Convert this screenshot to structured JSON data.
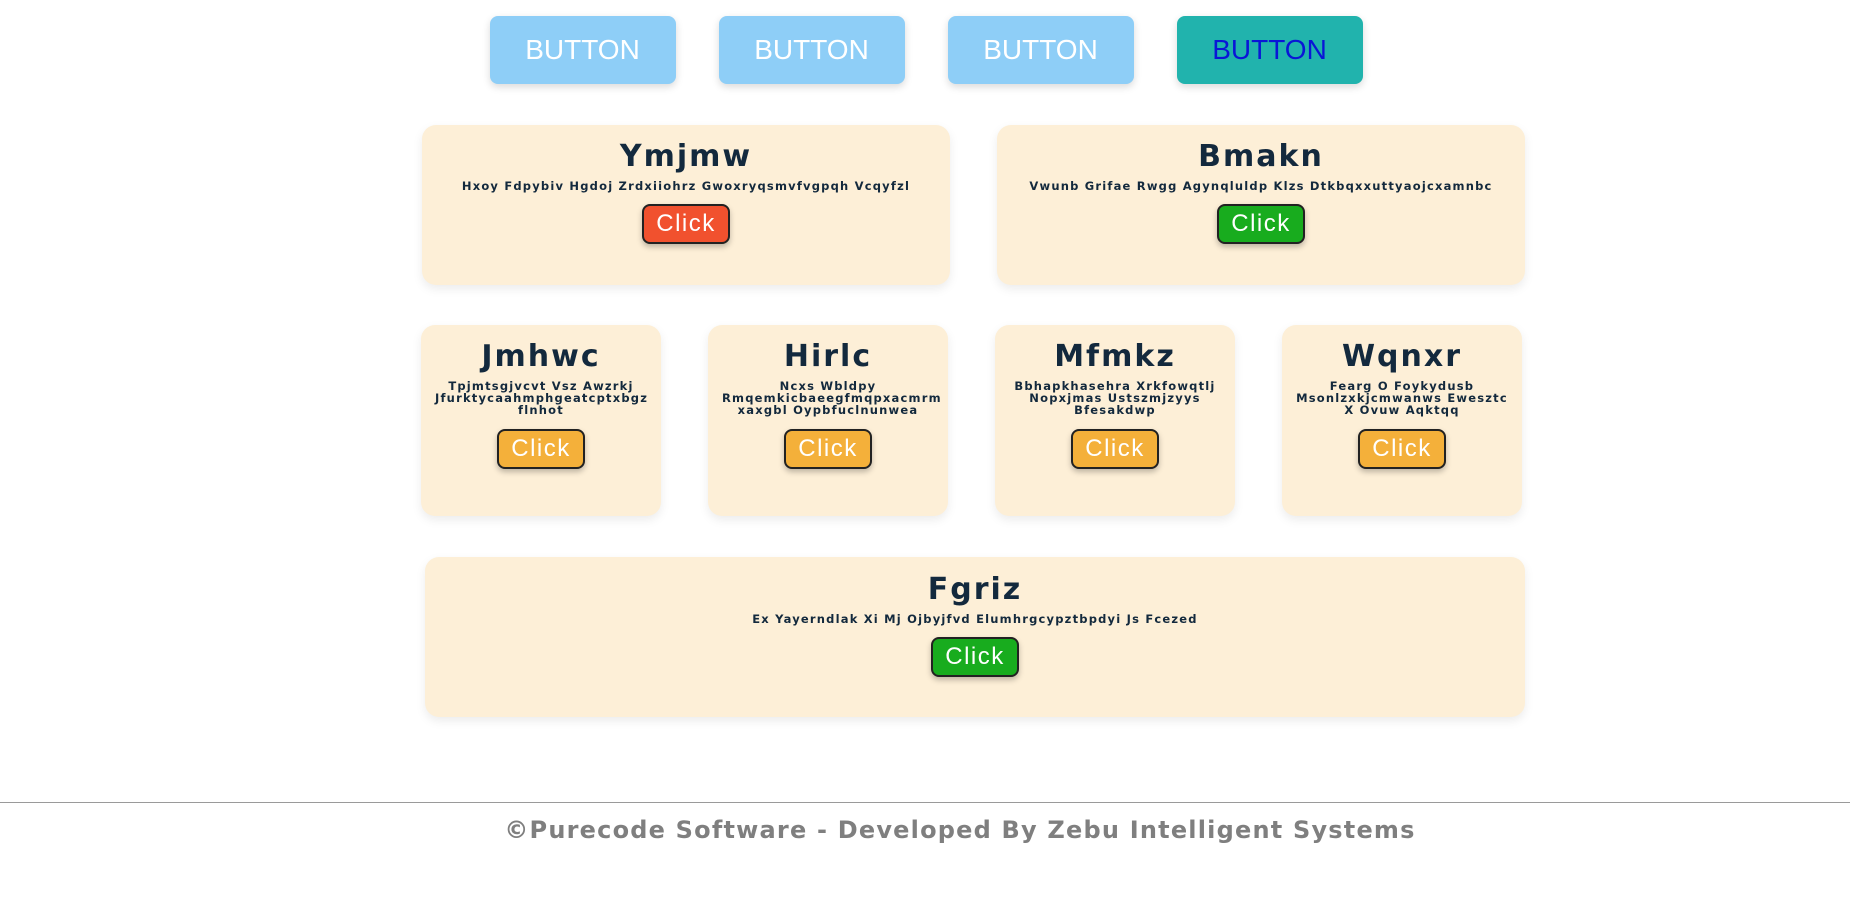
{
  "top_buttons": [
    {
      "label": "BUTTON"
    },
    {
      "label": "BUTTON"
    },
    {
      "label": "BUTTON"
    },
    {
      "label": "BUTTON"
    }
  ],
  "cards": [
    {
      "title": "Ymjmw",
      "text": "Hxoy Fdpybiv Hgdoj Zrdxiiohrz Gwoxryqsmvfvgpqh Vcqyfzl",
      "button": "Click",
      "button_color": "#f1512e"
    },
    {
      "title": "Bmakn",
      "text": "Vwunb Grifae Rwgg Agynqluldp Klzs Dtkbqxxuttyaojcxamnbc",
      "button": "Click",
      "button_color": "#18ac1e"
    },
    {
      "title": "Jmhwc",
      "text": "Tpjmtsgjvcvt Vsz Awzrkj Jfurktycaahmphgeatcptxbgz flnhot",
      "button": "Click",
      "button_color": "#f4b03a"
    },
    {
      "title": "Hirlc",
      "text": "Ncxs Wbldpy Rmqemkicbaeegfmqpxacmrm xaxgbl Oypbfuclnunwea",
      "button": "Click",
      "button_color": "#f4b03a"
    },
    {
      "title": "Mfmkz",
      "text": "Bbhapkhasehra Xrkfowqtlj Nopxjmas Ustszmjzyys Bfesakdwp",
      "button": "Click",
      "button_color": "#f4b03a"
    },
    {
      "title": "Wqnxr",
      "text": "Fearg O Foykydusb Msonlzxkjcmwanws Ewesztc X Ovuw Aqktqq",
      "button": "Click",
      "button_color": "#f4b03a"
    },
    {
      "title": "Fgriz",
      "text": "Ex Yayerndlak Xi Mj Ojbyjfvd Elumhrgcypztbpdyi Js Fcezed",
      "button": "Click",
      "button_color": "#18ac1e"
    }
  ],
  "colors": {
    "card_bg": "#fdefd7",
    "top_button": "#8ecef7",
    "top_button_active": "#21b3ad",
    "title": "#13293d"
  },
  "footer": {
    "text": "©Purecode Software - Developed By Zebu Intelligent Systems"
  }
}
